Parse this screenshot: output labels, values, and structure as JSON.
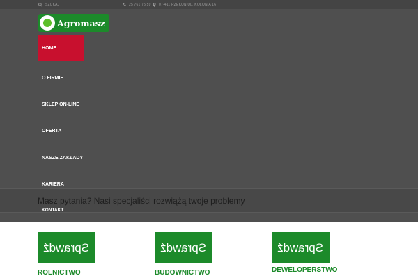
{
  "topbar": {
    "search_label": "SZUKAJ",
    "phone": "25 761 75 59",
    "address": "07-411 RZEKUN UL. KOLONIA 16"
  },
  "logo": {
    "text": "Agromasz"
  },
  "nav": {
    "items": [
      {
        "label": "HOME",
        "active": true
      },
      {
        "label": "O FIRMIE",
        "active": false
      },
      {
        "label": "SKLEP ON-LINE",
        "active": false
      },
      {
        "label": "OFERTA",
        "active": false
      },
      {
        "label": "NASZE ZAKŁADY",
        "active": false
      },
      {
        "label": "KARIERA",
        "active": false
      }
    ],
    "kontakt_label": "KONTAKT"
  },
  "banner": {
    "text": "Masz pytania? Nasi specjaliści rozwiążą twoje problemy"
  },
  "cards": [
    {
      "button_text": "Sprawdź",
      "label": "ROLNICTWO"
    },
    {
      "button_text": "Sprawdź",
      "label": "BUDOWNICTWO"
    },
    {
      "button_text": "Sprawdź",
      "label": "DEWELOPERSTWO"
    }
  ],
  "colors": {
    "accent_red": "#c8102e",
    "brand_green": "#1c8a2a",
    "dark_bg": "#4f4f4f"
  }
}
